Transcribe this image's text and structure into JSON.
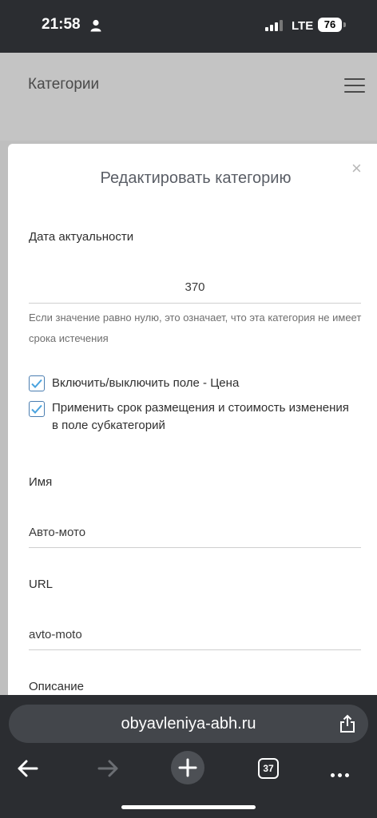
{
  "status": {
    "time": "21:58",
    "network": "LTE",
    "battery": "76"
  },
  "page": {
    "title": "Категории"
  },
  "modal": {
    "title": "Редактировать категорию",
    "close": "×",
    "expiry": {
      "label": "Дата актуальности",
      "value": "370"
    },
    "hint": "Если значение равно нулю, это означает, что эта категория не имеет срока истечения",
    "checkboxes": [
      {
        "label": "Включить/выключить поле - Цена",
        "checked": true
      },
      {
        "label": "Применить срок размещения и стоимость изменения в поле субкатегорий",
        "checked": true
      }
    ],
    "name": {
      "label": "Имя",
      "value": "Авто-мото"
    },
    "url": {
      "label": "URL",
      "value": "avto-moto"
    },
    "description": {
      "label": "Описание"
    }
  },
  "browser": {
    "url": "obyavleniya-abh.ru",
    "tab_count": "37"
  },
  "icons": {
    "person": "person-icon",
    "signal": "signal-icon",
    "hamburger": "hamburger-icon",
    "close": "close-icon",
    "check": "checkmark-icon",
    "share": "share-icon",
    "back": "back-arrow-icon",
    "forward": "forward-arrow-icon",
    "new_tab": "plus-icon",
    "tabs": "tabs-icon",
    "more": "more-icon"
  },
  "colors": {
    "accent": "#4a7db0",
    "checkmark": "#4aa3df",
    "chrome": "#2b2d31"
  }
}
